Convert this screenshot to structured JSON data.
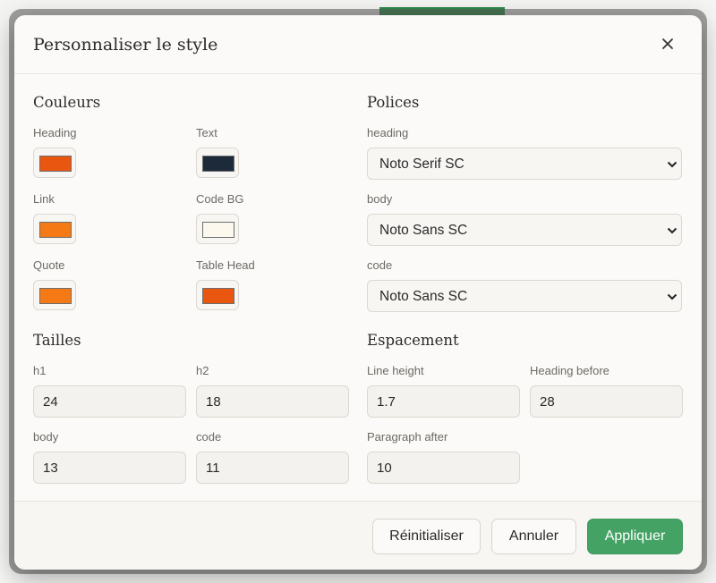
{
  "dialog": {
    "title": "Personnaliser le style",
    "close_icon": "close-icon"
  },
  "colors": {
    "title": "Couleurs",
    "items": [
      {
        "label": "Heading",
        "value": "#e8560f"
      },
      {
        "label": "Text",
        "value": "#1c2a3a"
      },
      {
        "label": "Link",
        "value": "#f57a16"
      },
      {
        "label": "Code BG",
        "value": "#fcf8ee"
      },
      {
        "label": "Quote",
        "value": "#f57a16"
      },
      {
        "label": "Table Head",
        "value": "#e8560f"
      }
    ]
  },
  "fonts": {
    "title": "Polices",
    "items": [
      {
        "label": "heading",
        "value": "Noto Serif SC"
      },
      {
        "label": "body",
        "value": "Noto Sans SC"
      },
      {
        "label": "code",
        "value": "Noto Sans SC"
      }
    ]
  },
  "sizes": {
    "title": "Tailles",
    "items": [
      {
        "label": "h1",
        "value": "24"
      },
      {
        "label": "h2",
        "value": "18"
      },
      {
        "label": "body",
        "value": "13"
      },
      {
        "label": "code",
        "value": "11"
      }
    ]
  },
  "spacing": {
    "title": "Espacement",
    "items": [
      {
        "label": "Line height",
        "value": "1.7"
      },
      {
        "label": "Heading before",
        "value": "28"
      },
      {
        "label": "Paragraph after",
        "value": "10"
      }
    ]
  },
  "footer": {
    "reset_label": "Réinitialiser",
    "cancel_label": "Annuler",
    "apply_label": "Appliquer",
    "apply_color": "#45a265"
  }
}
